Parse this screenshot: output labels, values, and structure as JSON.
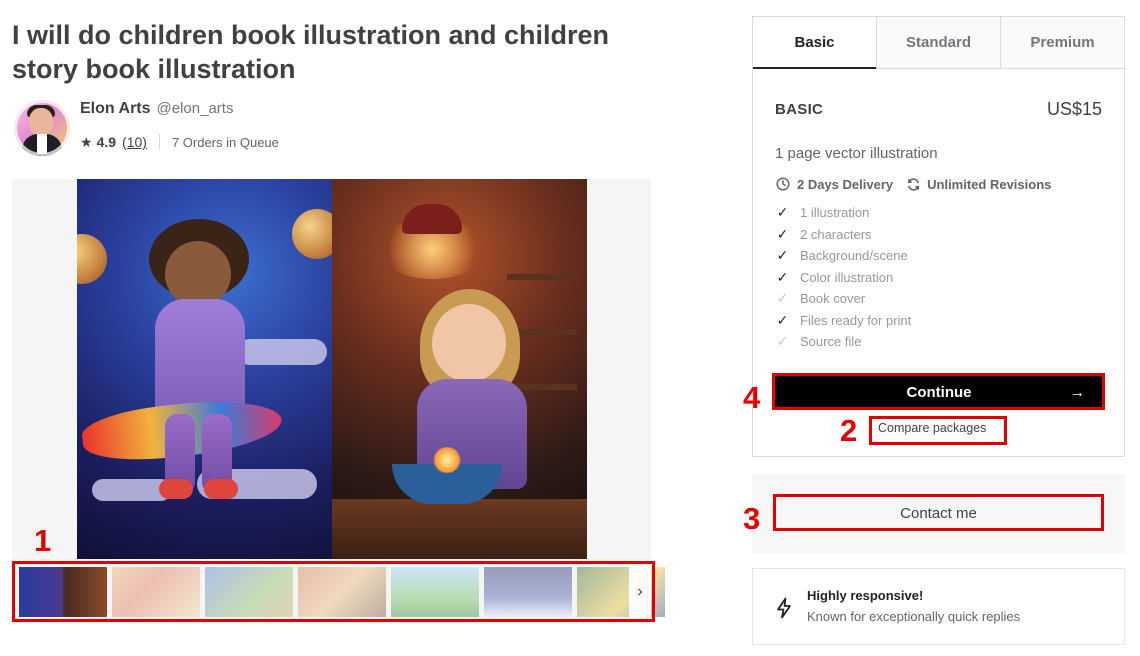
{
  "gig": {
    "title": "I will do children book illustration and children story book illustration"
  },
  "seller": {
    "name": "Elon Arts",
    "handle": "@elon_arts",
    "rating": "4.9",
    "reviews_count": "(10)",
    "orders_in_queue": "7 Orders in Queue"
  },
  "gallery": {
    "thumbnail_count": 7,
    "active_thumbnail_index": 0
  },
  "packages": {
    "tabs": [
      {
        "label": "Basic",
        "active": true
      },
      {
        "label": "Standard",
        "active": false
      },
      {
        "label": "Premium",
        "active": false
      }
    ],
    "selected": {
      "name": "BASIC",
      "price": "US$15",
      "description": "1 page vector illustration",
      "delivery": "2 Days Delivery",
      "revisions": "Unlimited Revisions",
      "features": [
        {
          "label": "1 illustration",
          "included": true
        },
        {
          "label": "2 characters",
          "included": true
        },
        {
          "label": "Background/scene",
          "included": true
        },
        {
          "label": "Color illustration",
          "included": true
        },
        {
          "label": "Book cover",
          "included": false
        },
        {
          "label": "Files ready for print",
          "included": true
        },
        {
          "label": "Source file",
          "included": false
        }
      ]
    },
    "continue_label": "Continue",
    "compare_label": "Compare packages"
  },
  "contact": {
    "button_label": "Contact me"
  },
  "responsive": {
    "title": "Highly responsive!",
    "subtitle": "Known for exceptionally quick replies"
  },
  "annotations": [
    {
      "number": "1",
      "target": "thumbnail-strip"
    },
    {
      "number": "2",
      "target": "compare-packages-link"
    },
    {
      "number": "3",
      "target": "contact-me-button"
    },
    {
      "number": "4",
      "target": "continue-button"
    }
  ],
  "colors": {
    "annotation_red": "#e30000",
    "primary_button": "#000000",
    "text_primary": "#404145",
    "text_muted": "#62646a"
  }
}
